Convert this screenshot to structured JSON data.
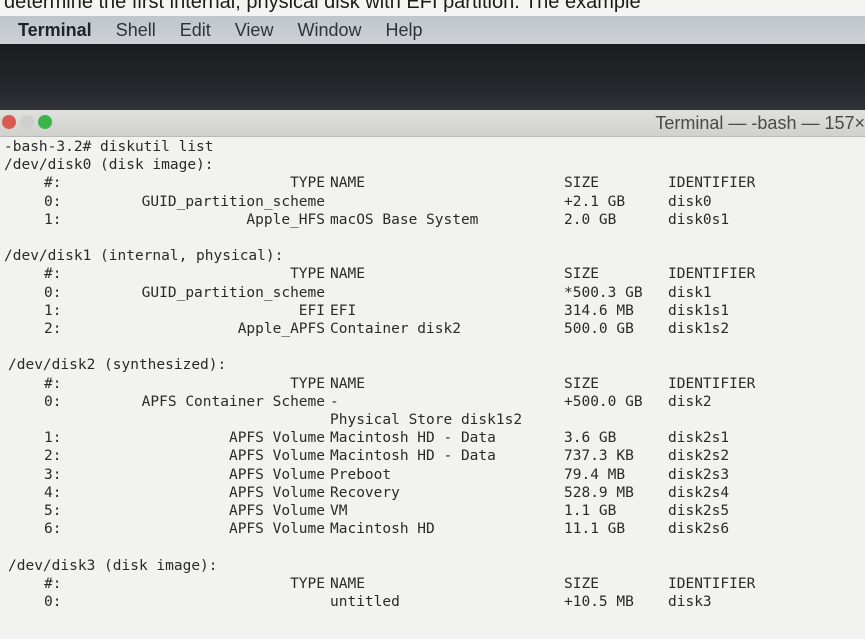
{
  "caption": "determine the first internal, physical disk with EFI partition. The example",
  "menubar": {
    "app": "Terminal",
    "items": [
      "Shell",
      "Edit",
      "View",
      "Window",
      "Help"
    ]
  },
  "window": {
    "title": "Terminal — -bash — 157×"
  },
  "terminal": {
    "prompt": "-bash-3.2# diskutil list",
    "disks": [
      {
        "header": "/dev/disk0 (disk image):",
        "columns": {
          "num": "#:",
          "type": "TYPE",
          "name": "NAME",
          "size": "SIZE",
          "id": "IDENTIFIER"
        },
        "rows": [
          {
            "num": "0:",
            "type": "GUID_partition_scheme",
            "name": "",
            "size": "+2.1 GB",
            "id": "disk0"
          },
          {
            "num": "1:",
            "type": "Apple_HFS",
            "name": "macOS Base System",
            "size": "2.0 GB",
            "id": "disk0s1"
          }
        ]
      },
      {
        "header": "/dev/disk1 (internal, physical):",
        "columns": {
          "num": "#:",
          "type": "TYPE",
          "name": "NAME",
          "size": "SIZE",
          "id": "IDENTIFIER"
        },
        "rows": [
          {
            "num": "0:",
            "type": "GUID_partition_scheme",
            "name": "",
            "size": "*500.3 GB",
            "id": "disk1"
          },
          {
            "num": "1:",
            "type": "EFI",
            "name": "EFI",
            "size": "314.6 MB",
            "id": "disk1s1"
          },
          {
            "num": "2:",
            "type": "Apple_APFS",
            "name": "Container disk2",
            "size": "500.0 GB",
            "id": "disk1s2"
          }
        ]
      },
      {
        "header": "/dev/disk2 (synthesized):",
        "columns": {
          "num": "#:",
          "type": "TYPE",
          "name": "NAME",
          "size": "SIZE",
          "id": "IDENTIFIER"
        },
        "rows": [
          {
            "num": "0:",
            "type": "APFS Container Scheme",
            "name": "-",
            "size": "+500.0 GB",
            "id": "disk2"
          },
          {
            "num": "",
            "type": "",
            "name": "Physical Store disk1s2",
            "size": "",
            "id": ""
          },
          {
            "num": "1:",
            "type": "APFS Volume",
            "name": "Macintosh HD - Data",
            "size": "3.6 GB",
            "id": "disk2s1"
          },
          {
            "num": "2:",
            "type": "APFS Volume",
            "name": "Macintosh HD - Data",
            "size": "737.3 KB",
            "id": "disk2s2"
          },
          {
            "num": "3:",
            "type": "APFS Volume",
            "name": "Preboot",
            "size": "79.4 MB",
            "id": "disk2s3"
          },
          {
            "num": "4:",
            "type": "APFS Volume",
            "name": "Recovery",
            "size": "528.9 MB",
            "id": "disk2s4"
          },
          {
            "num": "5:",
            "type": "APFS Volume",
            "name": "VM",
            "size": "1.1 GB",
            "id": "disk2s5"
          },
          {
            "num": "6:",
            "type": "APFS Volume",
            "name": "Macintosh HD",
            "size": "11.1 GB",
            "id": "disk2s6"
          }
        ]
      },
      {
        "header": "/dev/disk3 (disk image):",
        "columns": {
          "num": "#:",
          "type": "TYPE",
          "name": "NAME",
          "size": "SIZE",
          "id": "IDENTIFIER"
        },
        "rows": [
          {
            "num": "0:",
            "type": "",
            "name": "untitled",
            "size": "+10.5 MB",
            "id": "disk3"
          }
        ]
      }
    ]
  }
}
